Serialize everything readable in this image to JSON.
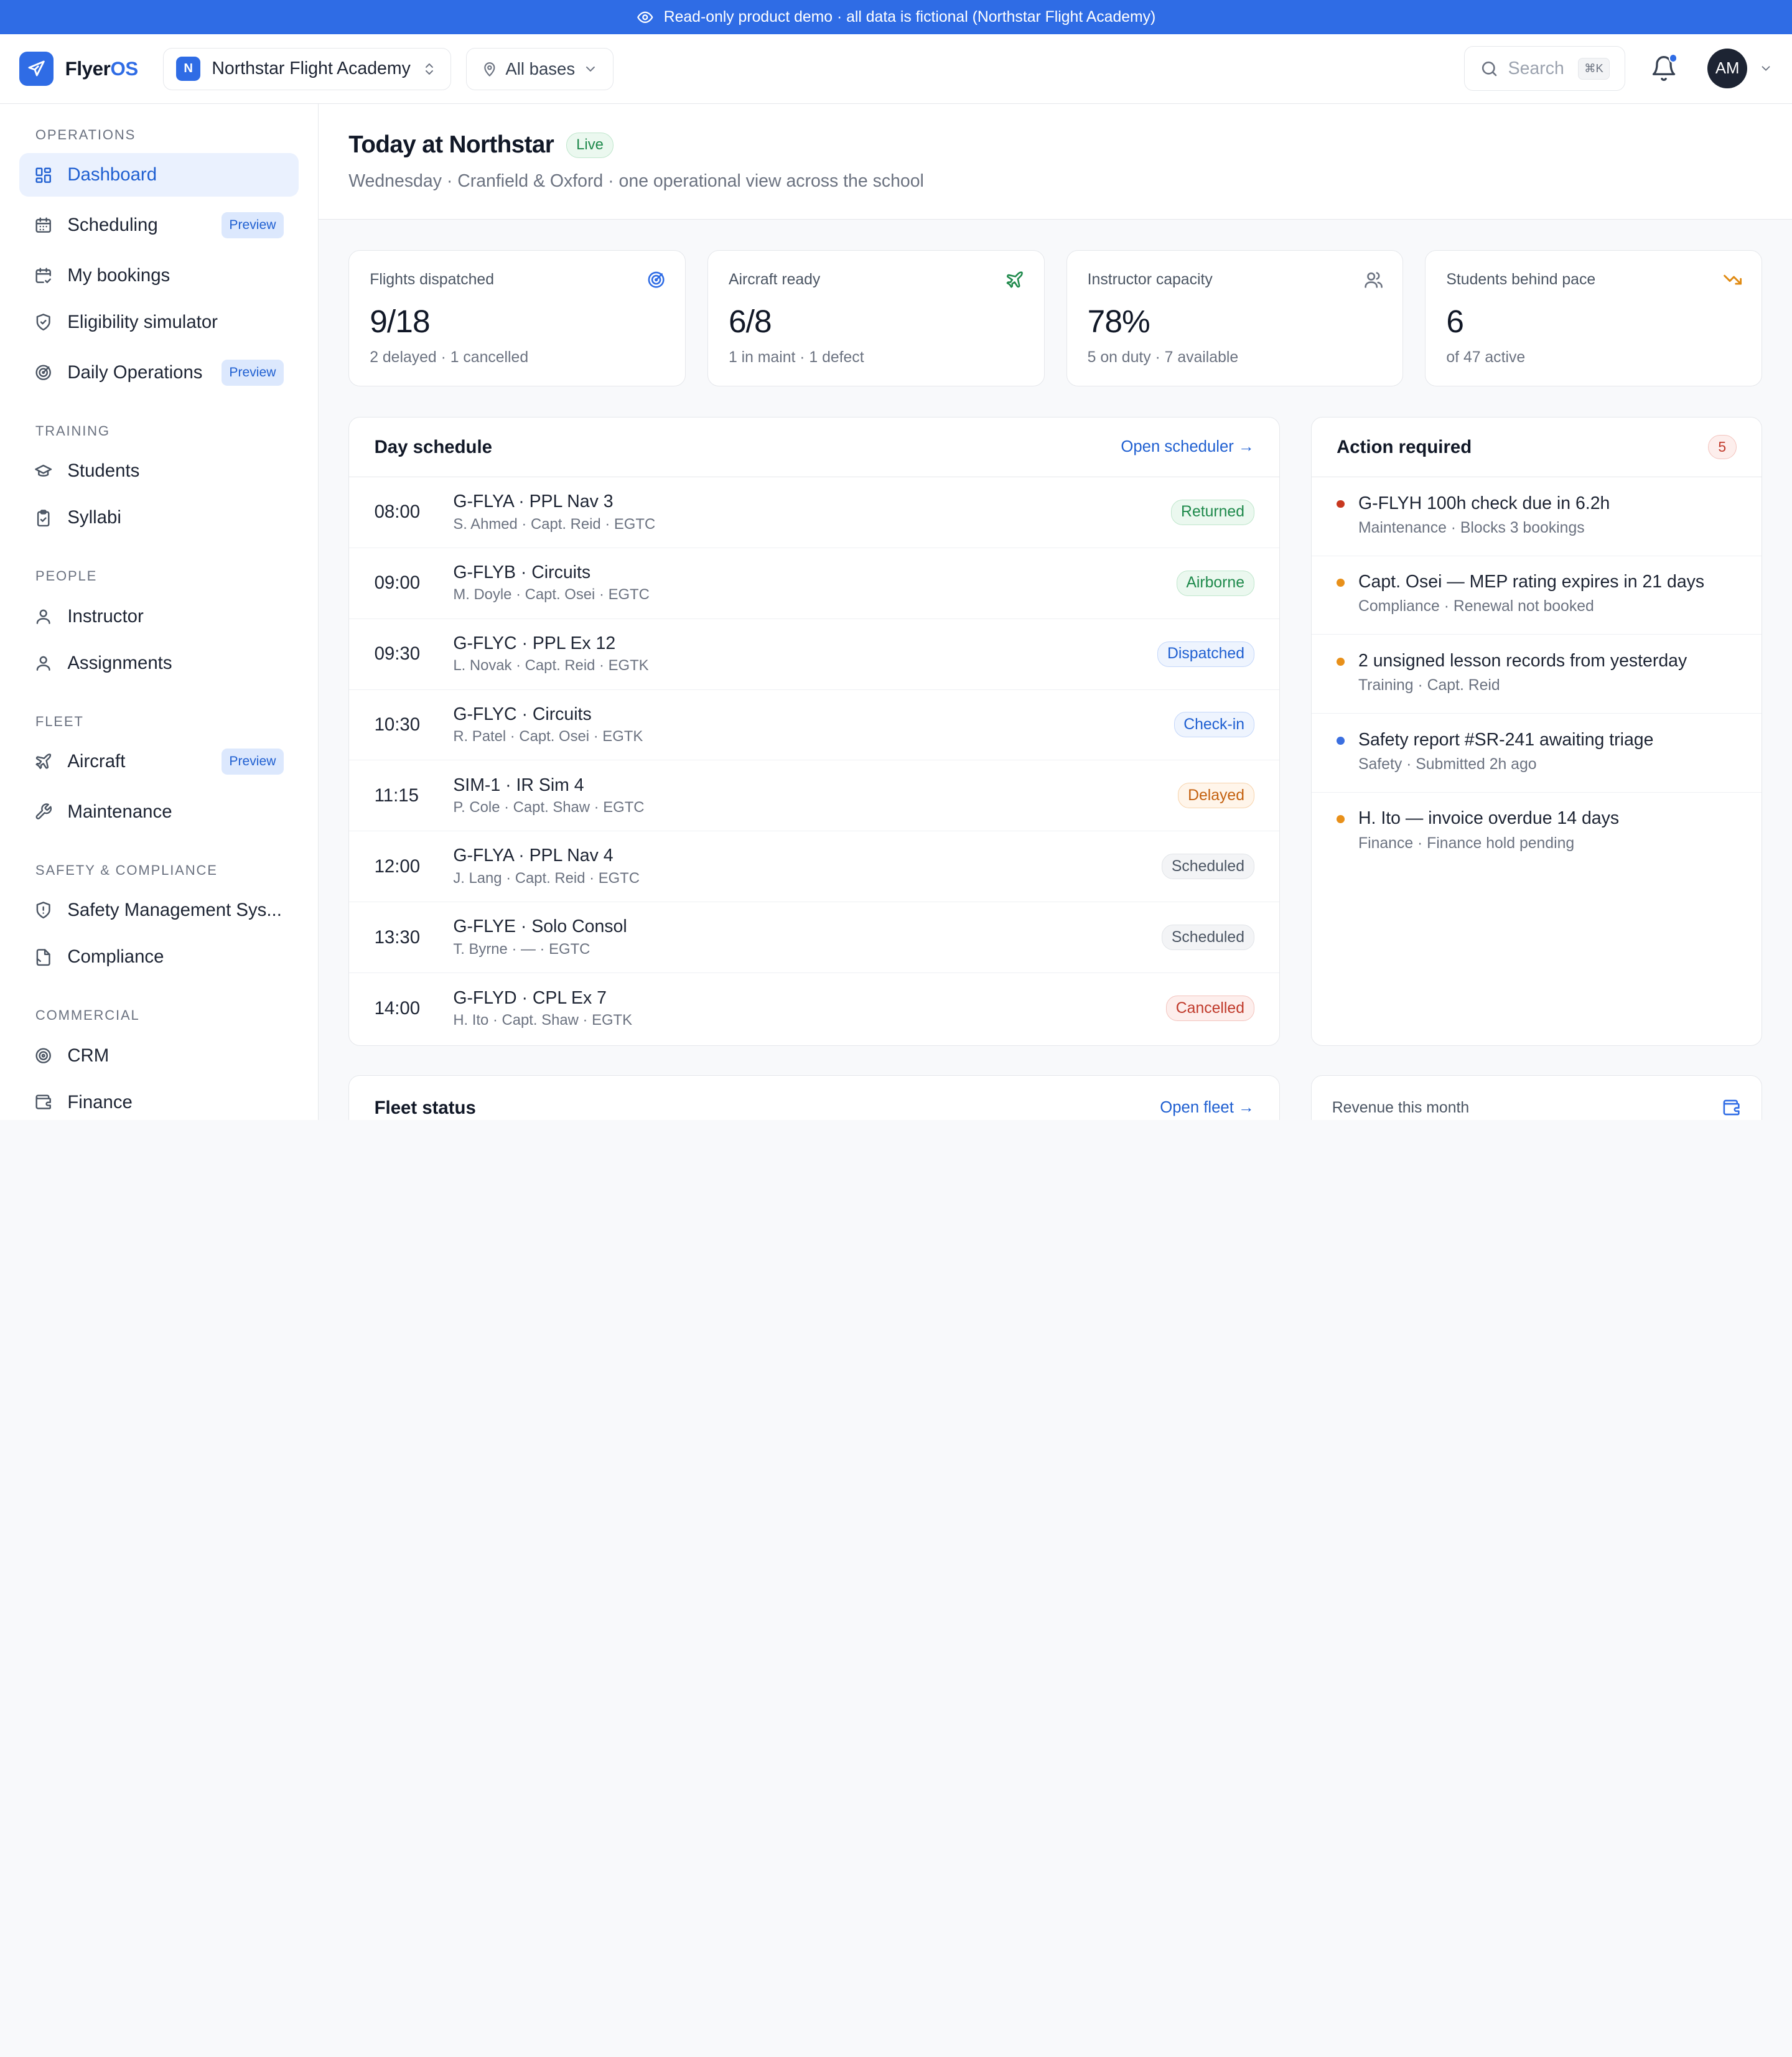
{
  "banner": {
    "text": "Read-only product demo · all data is fictional (Northstar Flight Academy)"
  },
  "brand": {
    "name_main": "Flyer",
    "name_accent": "OS"
  },
  "org": {
    "badge": "N",
    "name": "Northstar Flight Academy"
  },
  "base_filter": {
    "label": "All bases"
  },
  "search": {
    "placeholder": "Search",
    "shortcut": "⌘K"
  },
  "user": {
    "initials": "AM"
  },
  "sidebar": {
    "sections": [
      {
        "title": "OPERATIONS",
        "items": [
          {
            "label": "Dashboard",
            "icon": "dashboard-icon",
            "active": true
          },
          {
            "label": "Scheduling",
            "icon": "calendar-icon",
            "pill": "Preview"
          },
          {
            "label": "My bookings",
            "icon": "calendar-check-icon"
          },
          {
            "label": "Eligibility simulator",
            "icon": "shield-icon"
          },
          {
            "label": "Daily Operations",
            "icon": "radar-icon",
            "pill": "Preview"
          }
        ]
      },
      {
        "title": "TRAINING",
        "items": [
          {
            "label": "Students",
            "icon": "graduation-cap-icon"
          },
          {
            "label": "Syllabi",
            "icon": "clipboard-icon"
          }
        ]
      },
      {
        "title": "PEOPLE",
        "items": [
          {
            "label": "Instructor",
            "icon": "user-icon"
          },
          {
            "label": "Assignments",
            "icon": "user-icon"
          }
        ]
      },
      {
        "title": "FLEET",
        "items": [
          {
            "label": "Aircraft",
            "icon": "plane-icon",
            "pill": "Preview"
          },
          {
            "label": "Maintenance",
            "icon": "wrench-icon"
          }
        ]
      },
      {
        "title": "SAFETY & COMPLIANCE",
        "items": [
          {
            "label": "Safety Management Sys...",
            "icon": "shield-alert-icon"
          },
          {
            "label": "Compliance",
            "icon": "file-icon"
          }
        ]
      },
      {
        "title": "COMMERCIAL",
        "items": [
          {
            "label": "CRM",
            "icon": "target-icon"
          },
          {
            "label": "Finance",
            "icon": "wallet-icon"
          }
        ]
      }
    ]
  },
  "page": {
    "title": "Today at Northstar",
    "live": "Live",
    "subtitle": "Wednesday · Cranfield & Oxford · one operational view across the school"
  },
  "kpis": [
    {
      "label": "Flights dispatched",
      "value": "9/18",
      "sub": "2 delayed · 1 cancelled",
      "icon": "radar-icon",
      "color": "#2f6ce5"
    },
    {
      "label": "Aircraft ready",
      "value": "6/8",
      "sub": "1 in maint · 1 defect",
      "icon": "plane-icon",
      "color": "#1f8a4c"
    },
    {
      "label": "Instructor capacity",
      "value": "78%",
      "sub": "5 on duty · 7 available",
      "icon": "users-icon",
      "color": "#6b7280"
    },
    {
      "label": "Students behind pace",
      "value": "6",
      "sub": "of 47 active",
      "icon": "trending-down-icon",
      "color": "#e08a12"
    }
  ],
  "schedule": {
    "title": "Day schedule",
    "link": "Open scheduler →",
    "rows": [
      {
        "time": "08:00",
        "title": "G-FLYA · PPL Nav 3",
        "sub": "S. Ahmed · Capt. Reid · EGTC",
        "status": "Returned",
        "tone": "green"
      },
      {
        "time": "09:00",
        "title": "G-FLYB · Circuits",
        "sub": "M. Doyle · Capt. Osei · EGTC",
        "status": "Airborne",
        "tone": "green"
      },
      {
        "time": "09:30",
        "title": "G-FLYC · PPL Ex 12",
        "sub": "L. Novak · Capt. Reid · EGTK",
        "status": "Dispatched",
        "tone": "blue"
      },
      {
        "time": "10:30",
        "title": "G-FLYC · Circuits",
        "sub": "R. Patel · Capt. Osei · EGTK",
        "status": "Check-in",
        "tone": "blue"
      },
      {
        "time": "11:15",
        "title": "SIM-1 · IR Sim 4",
        "sub": "P. Cole · Capt. Shaw · EGTC",
        "status": "Delayed",
        "tone": "orange"
      },
      {
        "time": "12:00",
        "title": "G-FLYA · PPL Nav 4",
        "sub": "J. Lang · Capt. Reid · EGTC",
        "status": "Scheduled",
        "tone": "gray"
      },
      {
        "time": "13:30",
        "title": "G-FLYE · Solo Consol",
        "sub": "T. Byrne · — · EGTC",
        "status": "Scheduled",
        "tone": "gray"
      },
      {
        "time": "14:00",
        "title": "G-FLYD · CPL Ex 7",
        "sub": "H. Ito · Capt. Shaw · EGTK",
        "status": "Cancelled",
        "tone": "red"
      }
    ]
  },
  "actions": {
    "title": "Action required",
    "count": "5",
    "items": [
      {
        "title": "G-FLYH 100h check due in 6.2h",
        "sub": "Maintenance · Blocks 3 bookings",
        "dot": "#c8381f"
      },
      {
        "title": "Capt. Osei — MEP rating expires in 21 days",
        "sub": "Compliance · Renewal not booked",
        "dot": "#e8901a"
      },
      {
        "title": "2 unsigned lesson records from yesterday",
        "sub": "Training · Capt. Reid",
        "dot": "#e8901a"
      },
      {
        "title": "Safety report #SR-241 awaiting triage",
        "sub": "Safety · Submitted 2h ago",
        "dot": "#3b6fe0"
      },
      {
        "title": "H. Ito — invoice overdue 14 days",
        "sub": "Finance · Finance hold pending",
        "dot": "#e8901a"
      }
    ]
  },
  "fleet": {
    "title": "Fleet status",
    "link": "Open fleet →"
  },
  "revenue": {
    "label": "Revenue this month",
    "icon": "wallet-icon"
  },
  "colors": {
    "accent": "#2f6ce5",
    "banner": "#2f6ce5"
  }
}
